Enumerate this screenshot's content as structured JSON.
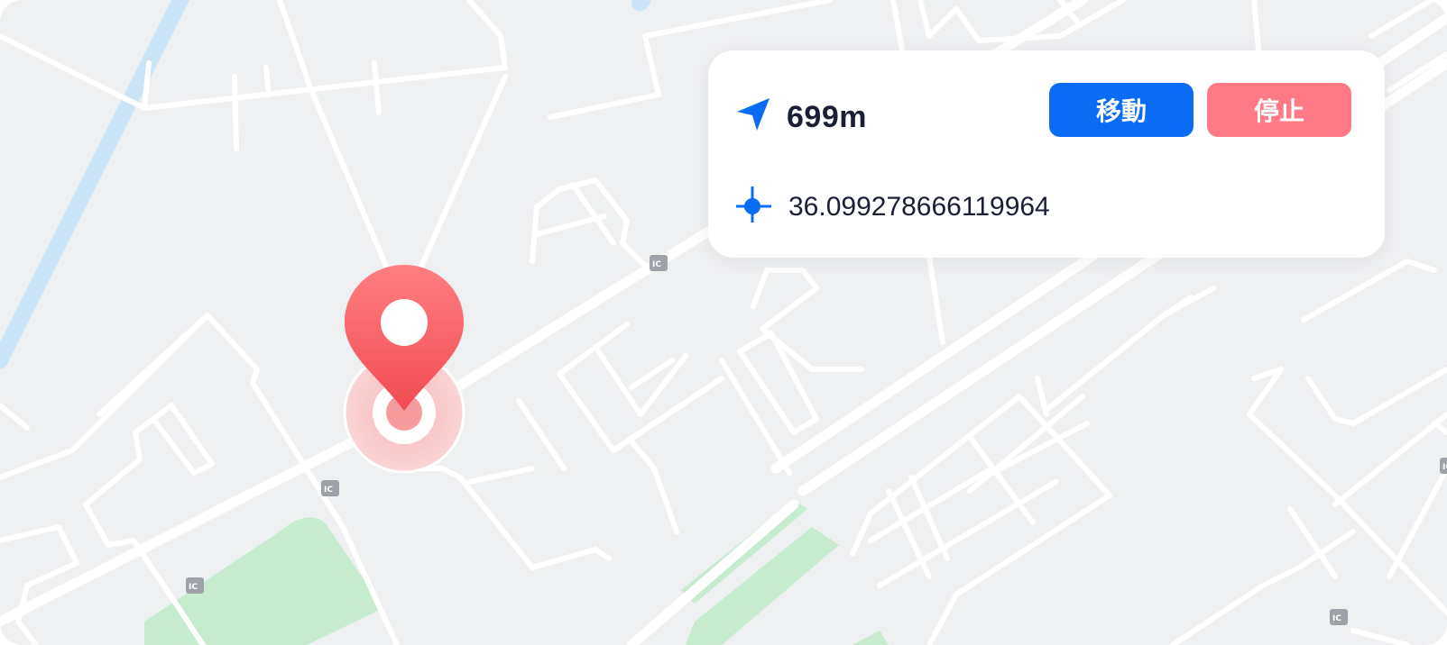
{
  "info_card": {
    "distance": "699m",
    "move_label": "移動",
    "stop_label": "停止",
    "coordinate": "36.099278666119964",
    "icons": [
      "navigation-arrow-icon",
      "crosshair-icon"
    ]
  },
  "map": {
    "marker_icon": "location-pin-icon",
    "transit_icon": "bus-stop-icon",
    "colors": {
      "background": "#eff0f2",
      "road": "#ffffff",
      "park": "#c6ebcf",
      "water": "#c9e3f7",
      "marker": "#f55a5f"
    }
  },
  "colors": {
    "primary": "#0a6cf5",
    "stop": "#ff7a85",
    "text": "#1a1f36"
  }
}
